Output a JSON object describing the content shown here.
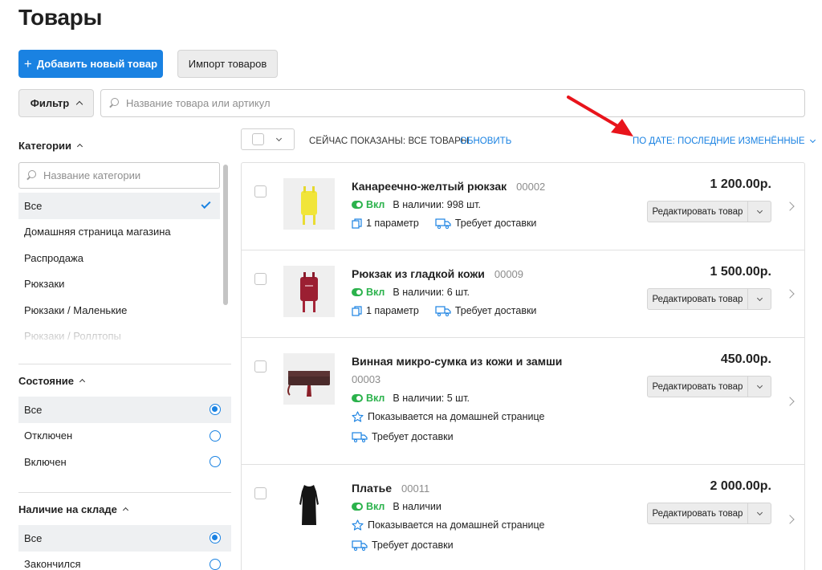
{
  "page": {
    "title": "Товары"
  },
  "toolbar": {
    "add_label": "Добавить новый товар",
    "import_label": "Импорт товаров",
    "filter_label": "Фильтр",
    "search_placeholder": "Название товара или артикул"
  },
  "colors": {
    "accent": "#1a82e2",
    "status_on": "#2bb24c",
    "annotation_arrow": "#e8141b"
  },
  "sidebar": {
    "categories": {
      "heading": "Категории",
      "search_placeholder": "Название категории",
      "items": [
        {
          "label": "Все",
          "selected": true
        },
        {
          "label": "Домашняя страница магазина",
          "selected": false
        },
        {
          "label": "Распродажа",
          "selected": false
        },
        {
          "label": "Рюкзаки",
          "selected": false
        },
        {
          "label": "Рюкзаки / Маленькие",
          "selected": false
        },
        {
          "label": "Рюкзаки / Роллтопы",
          "selected": false
        }
      ]
    },
    "state": {
      "heading": "Состояние",
      "items": [
        {
          "label": "Все",
          "selected": true
        },
        {
          "label": "Отключен",
          "selected": false
        },
        {
          "label": "Включен",
          "selected": false
        }
      ]
    },
    "stock": {
      "heading": "Наличие на складе",
      "items": [
        {
          "label": "Все",
          "selected": true
        },
        {
          "label": "Закончился",
          "selected": false
        }
      ]
    }
  },
  "list_header": {
    "showing_text": "СЕЙЧАС ПОКАЗАНЫ: ВСЕ ТОВАРЫ",
    "refresh_label": "ОБНОВИТЬ",
    "sort_label": "ПО ДАТЕ: ПОСЛЕДНИЕ ИЗМЕНЁННЫЕ"
  },
  "products": [
    {
      "name": "Канареечно-желтый рюкзак",
      "sku": "00002",
      "price": "1 200.00р.",
      "status": "Вкл",
      "stock": "В наличии: 998 шт.",
      "params": "1 параметр",
      "shipping": "Требует доставки",
      "edit_label": "Редактировать товар",
      "thumb_icon": "yellow-backpack-photo"
    },
    {
      "name": "Рюкзак из гладкой кожи",
      "sku": "00009",
      "price": "1 500.00р.",
      "status": "Вкл",
      "stock": "В наличии: 6 шт.",
      "params": "1 параметр",
      "shipping": "Требует доставки",
      "edit_label": "Редактировать товар",
      "thumb_icon": "red-leather-backpack-photo"
    },
    {
      "name": "Винная микро-сумка из кожи и замши",
      "sku": "00003",
      "price": "450.00р.",
      "status": "Вкл",
      "stock": "В наличии: 5 шт.",
      "featured": "Показывается на домашней странице",
      "shipping": "Требует доставки",
      "edit_label": "Редактировать товар",
      "thumb_icon": "wine-clutch-photo"
    },
    {
      "name": "Платье",
      "sku": "00011",
      "price": "2 000.00р.",
      "status": "Вкл",
      "stock": "В наличии",
      "featured": "Показывается на домашней странице",
      "shipping": "Требует доставки",
      "edit_label": "Редактировать товар",
      "thumb_icon": "black-dress-photo"
    }
  ]
}
